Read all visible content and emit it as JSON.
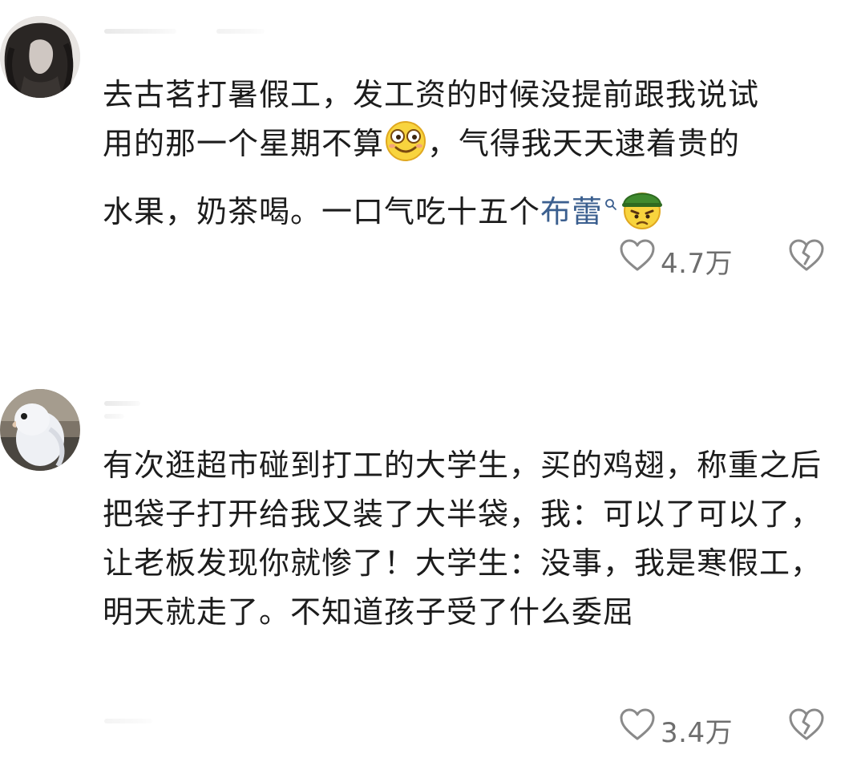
{
  "comments": [
    {
      "line1": "去古茗打暑假工，发工资的时候没提前跟我说试",
      "line2_a": "用的那一个星期不算",
      "line2_b": "，气得我天天逮着贵的",
      "line3_a": "水果，奶茶喝。一口气吃十五个",
      "link_text": "布蕾",
      "emoji1": "smiling-face-emoji",
      "emoji2": "angry-face-helmet-emoji",
      "likes": "4.7万"
    },
    {
      "text": "有次逛超市碰到打工的大学生，买的鸡翅，称重之后把袋子打开给我又装了大半袋，我：可以了可以了，让老板发现你就惨了！大学生：没事，我是寒假工，明天就走了。不知道孩子受了什么委屈",
      "likes": "3.4万"
    }
  ],
  "colors": {
    "link": "#3b5f8f",
    "count": "#6e6e6e",
    "icon": "#8a8a8a"
  }
}
